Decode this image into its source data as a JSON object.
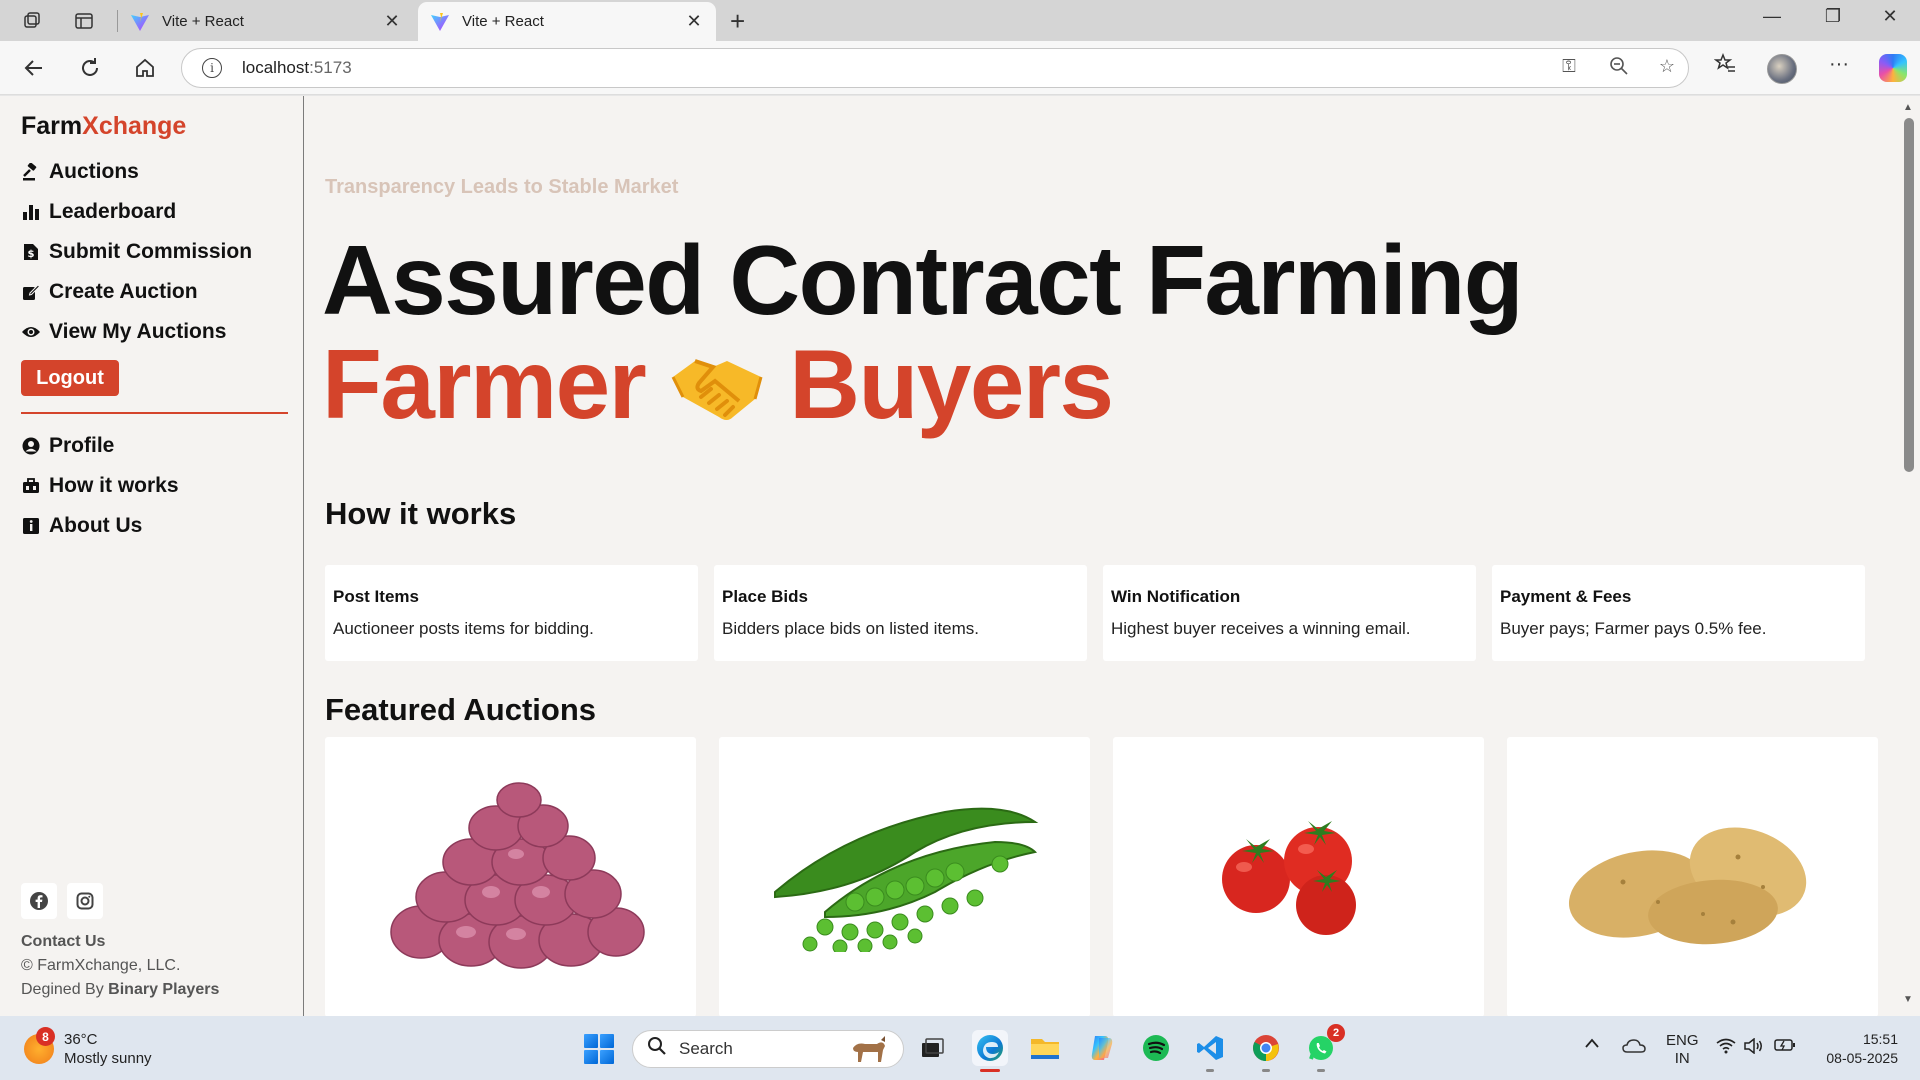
{
  "browser": {
    "tabs": [
      {
        "title": "Vite + React",
        "active": false
      },
      {
        "title": "Vite + React",
        "active": true
      }
    ],
    "url_host": "localhost",
    "url_port": ":5173"
  },
  "sidebar": {
    "brand_part1": "Farm",
    "brand_part2": "Xchange",
    "nav_items": [
      {
        "label": "Auctions",
        "icon": "gavel-icon"
      },
      {
        "label": "Leaderboard",
        "icon": "bar-chart-icon"
      },
      {
        "label": "Submit Commission",
        "icon": "dollar-file-icon"
      },
      {
        "label": "Create Auction",
        "icon": "edit-icon"
      },
      {
        "label": "View My Auctions",
        "icon": "eye-icon"
      }
    ],
    "logout_label": "Logout",
    "secondary_items": [
      {
        "label": "Profile",
        "icon": "user-circle-icon"
      },
      {
        "label": "How it works",
        "icon": "briefcase-icon"
      },
      {
        "label": "About Us",
        "icon": "info-square-icon"
      }
    ],
    "contact_label": "Contact Us",
    "copyright": "© FarmXchange, LLC.",
    "designed_by_prefix": "Degined By ",
    "designed_by_name": "Binary Players"
  },
  "main": {
    "tagline": "Transparency Leads to Stable Market",
    "hero_line1": "Assured Contract Farming",
    "hero_farmer": "Farmer",
    "hero_buyers": "Buyers",
    "how_title": "How it works",
    "steps": [
      {
        "title": "Post Items",
        "desc": "Auctioneer posts items for bidding."
      },
      {
        "title": "Place Bids",
        "desc": "Bidders place bids on listed items."
      },
      {
        "title": "Win Notification",
        "desc": "Highest buyer receives a winning email."
      },
      {
        "title": "Payment & Fees",
        "desc": "Buyer pays; Farmer pays 0.5% fee."
      }
    ],
    "featured_title": "Featured Auctions",
    "featured_items": [
      "onions-image",
      "peas-image",
      "tomatoes-image",
      "potatoes-image"
    ]
  },
  "taskbar": {
    "weather_temp": "36°C",
    "weather_desc": "Mostly sunny",
    "weather_badge": "8",
    "search_placeholder": "Search",
    "whatsapp_badge": "2",
    "lang_line1": "ENG",
    "lang_line2": "IN",
    "time": "15:51",
    "date": "08-05-2025"
  },
  "colors": {
    "accent": "#d4442b",
    "tagline": "#d8c4b8",
    "page_bg": "#f5f3f1"
  }
}
